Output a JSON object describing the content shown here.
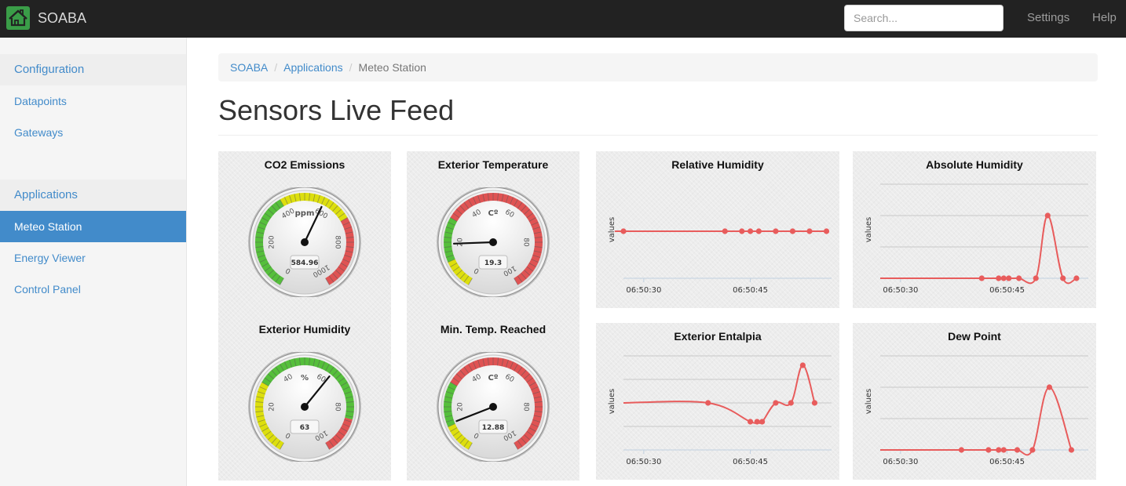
{
  "navbar": {
    "brand": "SOABA",
    "search_placeholder": "Search...",
    "links": [
      "Settings",
      "Help"
    ]
  },
  "sidebar": {
    "items": [
      {
        "label": "Configuration",
        "type": "header"
      },
      {
        "label": "Datapoints",
        "type": "link"
      },
      {
        "label": "Gateways",
        "type": "link"
      },
      {
        "label": "Applications",
        "type": "header"
      },
      {
        "label": "Meteo Station",
        "type": "active"
      },
      {
        "label": "Energy Viewer",
        "type": "link"
      },
      {
        "label": "Control Panel",
        "type": "link"
      }
    ]
  },
  "breadcrumb": {
    "items": [
      "SOABA",
      "Applications",
      "Meteo Station"
    ],
    "separator": "/"
  },
  "page_title": "Sensors Live Feed",
  "colors": {
    "accent": "#428bca",
    "navbar": "#222222",
    "gauge_green": "#55bf3b",
    "gauge_yellow": "#dddf0d",
    "gauge_red": "#df5353",
    "series": "#e85c5c"
  },
  "gauges": [
    {
      "title": "CO2 Emissions",
      "unit": "ppm",
      "value": 584.96,
      "value_label": "584.96",
      "min": 0,
      "max": 1000,
      "ticks": [
        "0",
        "200",
        "400",
        "600",
        "800",
        "1000"
      ],
      "bands": [
        {
          "from": 0,
          "to": 400,
          "color": "green"
        },
        {
          "from": 400,
          "to": 700,
          "color": "yellow"
        },
        {
          "from": 700,
          "to": 1000,
          "color": "red"
        }
      ]
    },
    {
      "title": "Exterior Temperature",
      "unit": "Cº",
      "value": 19.3,
      "value_label": "19.3",
      "min": 0,
      "max": 100,
      "ticks": [
        "0",
        "20",
        "40",
        "60",
        "80",
        "100"
      ],
      "bands": [
        {
          "from": 0,
          "to": 12,
          "color": "yellow"
        },
        {
          "from": 12,
          "to": 30,
          "color": "green"
        },
        {
          "from": 30,
          "to": 100,
          "color": "red"
        }
      ]
    },
    {
      "title": "Exterior Humidity",
      "unit": "%",
      "value": 63,
      "value_label": "63",
      "min": 0,
      "max": 100,
      "ticks": [
        "0",
        "20",
        "40",
        "60",
        "80",
        "100"
      ],
      "bands": [
        {
          "from": 0,
          "to": 30,
          "color": "yellow"
        },
        {
          "from": 30,
          "to": 85,
          "color": "green"
        },
        {
          "from": 85,
          "to": 100,
          "color": "red"
        }
      ]
    },
    {
      "title": "Min. Temp. Reached",
      "unit": "Cº",
      "value": 12.88,
      "value_label": "12.88",
      "min": 0,
      "max": 100,
      "ticks": [
        "0",
        "20",
        "40",
        "60",
        "80",
        "100"
      ],
      "bands": [
        {
          "from": 0,
          "to": 12,
          "color": "yellow"
        },
        {
          "from": 12,
          "to": 30,
          "color": "green"
        },
        {
          "from": 30,
          "to": 100,
          "color": "red"
        }
      ]
    }
  ],
  "chart_data": [
    {
      "type": "line",
      "title": "Relative Humidity",
      "ylabel": "values",
      "x_ticks": [
        "06:50:30",
        "06:50:45"
      ],
      "x": [
        0,
        6,
        7,
        7.5,
        8,
        9,
        10,
        11,
        12
      ],
      "y": [
        1,
        1,
        1,
        1,
        1,
        1,
        1,
        1,
        1
      ],
      "ylim": [
        0,
        2
      ],
      "grid": false
    },
    {
      "type": "line",
      "title": "Absolute Humidity",
      "ylabel": "values",
      "x_ticks": [
        "06:50:30",
        "06:50:45"
      ],
      "x": [
        6,
        7,
        7.3,
        7.6,
        8.2,
        9.2,
        9.9,
        10.8,
        11.6
      ],
      "y": [
        0,
        0,
        0,
        0,
        0,
        0,
        2,
        0,
        0
      ],
      "ylim": [
        0,
        3
      ],
      "grid": true
    },
    {
      "type": "line",
      "title": "Exterior Entalpia",
      "ylabel": "values",
      "x_ticks": [
        "06:50:30",
        "06:50:45"
      ],
      "x": [
        5,
        7.5,
        7.9,
        8.2,
        9,
        9.9,
        10.6,
        11.3
      ],
      "y": [
        0,
        -0.8,
        -0.8,
        -0.8,
        0,
        0,
        1.6,
        0
      ],
      "ylim": [
        -2,
        2
      ],
      "grid": true
    },
    {
      "type": "line",
      "title": "Dew Point",
      "ylabel": "values",
      "x_ticks": [
        "06:50:30",
        "06:50:45"
      ],
      "x": [
        4.8,
        6.4,
        7,
        7.3,
        8.1,
        9,
        10,
        11.3
      ],
      "y": [
        0,
        0,
        0,
        0,
        0,
        0,
        2,
        0
      ],
      "ylim": [
        0,
        3
      ],
      "grid": true
    }
  ]
}
